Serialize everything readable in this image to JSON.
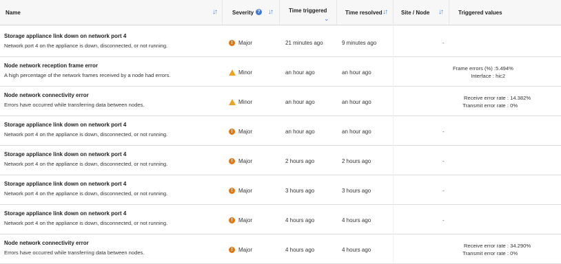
{
  "columns": {
    "name": "Name",
    "severity": "Severity",
    "time_triggered": "Time triggered",
    "time_resolved": "Time resolved",
    "site_node": "Site / Node",
    "triggered_values": "Triggered values"
  },
  "rows": [
    {
      "name": "Storage appliance link down on network port 4",
      "desc": "Network port 4 on the appliance is down, disconnected, or not running.",
      "severity": "Major",
      "severity_icon": "major-icon",
      "triggered": "21 minutes ago",
      "resolved": "9 minutes ago",
      "site": "-",
      "values": []
    },
    {
      "name": "Node network reception frame error",
      "desc": "A high percentage of the network frames received by a node had errors.",
      "severity": "Minor",
      "severity_icon": "minor-icon",
      "triggered": "an hour ago",
      "resolved": "an hour ago",
      "site": "",
      "values": [
        {
          "k": "Frame errors (%) :",
          "v": "5.494%"
        },
        {
          "k": "Interface :",
          "v": "hic2"
        }
      ]
    },
    {
      "name": "Node network connectivity error",
      "desc": "Errors have occurred while transferring data between nodes.",
      "severity": "Minor",
      "severity_icon": "minor-icon",
      "triggered": "an hour ago",
      "resolved": "an hour ago",
      "site": "",
      "values": [
        {
          "k": "Receive error rate :",
          "v": "14.382%"
        },
        {
          "k": "Transmit error rate :",
          "v": "0%"
        }
      ]
    },
    {
      "name": "Storage appliance link down on network port 4",
      "desc": "Network port 4 on the appliance is down, disconnected, or not running.",
      "severity": "Major",
      "severity_icon": "major-icon",
      "triggered": "an hour ago",
      "resolved": "an hour ago",
      "site": "-",
      "values": []
    },
    {
      "name": "Storage appliance link down on network port 4",
      "desc": "Network port 4 on the appliance is down, disconnected, or not running.",
      "severity": "Major",
      "severity_icon": "major-icon",
      "triggered": "2 hours ago",
      "resolved": "2 hours ago",
      "site": "-",
      "values": []
    },
    {
      "name": "Storage appliance link down on network port 4",
      "desc": "Network port 4 on the appliance is down, disconnected, or not running.",
      "severity": "Major",
      "severity_icon": "major-icon",
      "triggered": "3 hours ago",
      "resolved": "3 hours ago",
      "site": "-",
      "values": []
    },
    {
      "name": "Storage appliance link down on network port 4",
      "desc": "Network port 4 on the appliance is down, disconnected, or not running.",
      "severity": "Major",
      "severity_icon": "major-icon",
      "triggered": "4 hours ago",
      "resolved": "4 hours ago",
      "site": "-",
      "values": []
    },
    {
      "name": "Node network connectivity error",
      "desc": "Errors have occurred while transferring data between nodes.",
      "severity": "Major",
      "severity_icon": "major-icon",
      "triggered": "4 hours ago",
      "resolved": "4 hours ago",
      "site": "",
      "values": [
        {
          "k": "Receive error rate :",
          "v": "34.290%"
        },
        {
          "k": "Transmit error rate :",
          "v": "0%"
        }
      ]
    }
  ],
  "colors": {
    "accent": "#3d7ad6",
    "major": "#e8760c",
    "minor": "#f0a321"
  }
}
